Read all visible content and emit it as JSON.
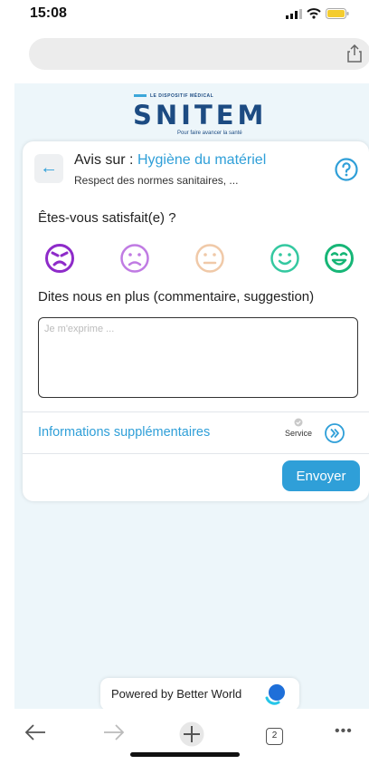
{
  "status_bar": {
    "time": "15:08"
  },
  "logo": {
    "tagline": "LE DISPOSITIF MÉDICAL",
    "wordmark": "SNITEM",
    "subline": "Pour faire avancer la santé"
  },
  "card": {
    "avis_prefix": "Avis sur :",
    "avis_topic": "Hygiène du matériel",
    "subtitle": "Respect des normes sanitaires, ...",
    "question": "Êtes-vous satisfait(e) ?",
    "emojis": [
      {
        "name": "very-unhappy-face-icon",
        "color": "#8e2bc9"
      },
      {
        "name": "unhappy-face-icon",
        "color": "#c07be3"
      },
      {
        "name": "neutral-face-icon",
        "color": "#f0c9a8"
      },
      {
        "name": "happy-face-icon",
        "color": "#34c8a0"
      },
      {
        "name": "very-happy-face-icon",
        "color": "#17b677"
      }
    ],
    "more_label": "Dites nous en plus (commentaire, suggestion)",
    "comment_placeholder": "Je m'exprime ...",
    "infos_label": "Informations supplémentaires",
    "service_label": "Service",
    "send_label": "Envoyer"
  },
  "powered": {
    "text": "Powered by Better World"
  },
  "toolbar": {
    "tab_count": "2",
    "more": "•••"
  },
  "colors": {
    "accent": "#2f9fd8",
    "brand": "#1c4b82",
    "page_bg": "#edf6fa"
  }
}
